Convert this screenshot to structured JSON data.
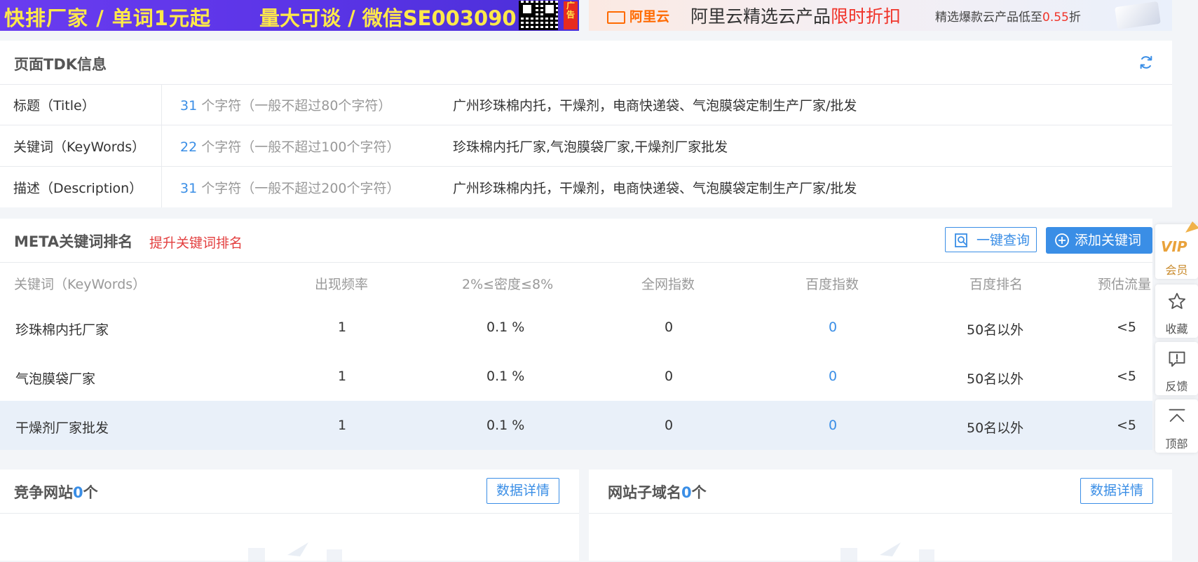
{
  "ads": {
    "left": {
      "text1": "快排厂家 / 单词1元起",
      "text2": "量大可谈 / 微信SE003090",
      "tag": "广告"
    },
    "right": {
      "brand": "阿里云",
      "headline": "阿里云精选云产品",
      "headline_highlight": "限时折扣",
      "sub": "精选爆款云产品低至",
      "sub_highlight": "0.55",
      "sub_suffix": "折"
    }
  },
  "tdk": {
    "title": "页面TDK信息",
    "rows": [
      {
        "label": "标题（Title）",
        "count": "31",
        "count_note": " 个字符（一般不超过80个字符）",
        "value": "广州珍珠棉内托，干燥剂，电商快递袋、气泡膜袋定制生产厂家/批发"
      },
      {
        "label": "关键词（KeyWords）",
        "count": "22",
        "count_note": " 个字符（一般不超过100个字符）",
        "value": "珍珠棉内托厂家,气泡膜袋厂家,干燥剂厂家批发"
      },
      {
        "label": "描述（Description）",
        "count": "31",
        "count_note": " 个字符（一般不超过200个字符）",
        "value": "广州珍珠棉内托，干燥剂，电商快递袋、气泡膜袋定制生产厂家/批发"
      }
    ]
  },
  "meta": {
    "title": "META关键词排名",
    "improve_link": "提升关键词排名",
    "query_button": "一键查询",
    "add_button": "添加关键词",
    "columns": [
      "关键词（KeyWords）",
      "出现频率",
      "2%≤密度≤8%",
      "全网指数",
      "百度指数",
      "百度排名",
      "预估流量"
    ],
    "rows": [
      {
        "keyword": "珍珠棉内托厂家",
        "freq": "1",
        "density": "0.1 %",
        "all_index": "0",
        "baidu_index": "0",
        "baidu_rank": "50名以外",
        "traffic": "<5"
      },
      {
        "keyword": "气泡膜袋厂家",
        "freq": "1",
        "density": "0.1 %",
        "all_index": "0",
        "baidu_index": "0",
        "baidu_rank": "50名以外",
        "traffic": "<5"
      },
      {
        "keyword": "干燥剂厂家批发",
        "freq": "1",
        "density": "0.1 %",
        "all_index": "0",
        "baidu_index": "0",
        "baidu_rank": "50名以外",
        "traffic": "<5"
      }
    ]
  },
  "competitors": {
    "title": "竞争网站",
    "count": "0",
    "unit": "个",
    "button": "数据详情"
  },
  "subdomains": {
    "title": "网站子域名",
    "count": "0",
    "unit": "个",
    "button": "数据详情"
  },
  "floatbar": {
    "vip_badge": "VIP",
    "vip_label": "会员",
    "fav_label": "收藏",
    "feedback_label": "反馈",
    "top_label": "顶部"
  },
  "colors": {
    "accent": "#3a8ee6",
    "danger": "#e33e3e",
    "highlight_row": "#e9f0f9"
  }
}
